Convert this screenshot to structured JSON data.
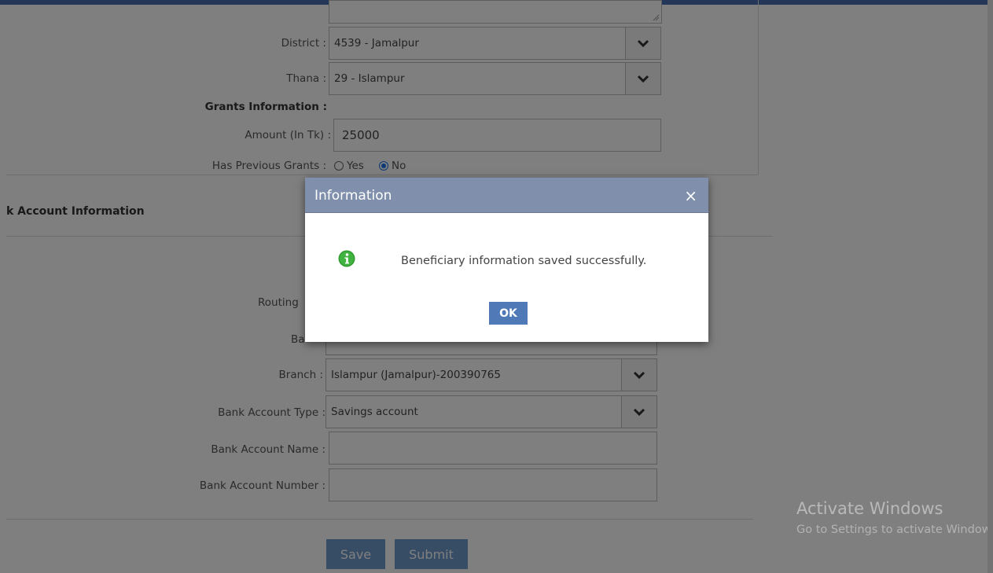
{
  "form": {
    "district": {
      "label": "District :",
      "value": "4539 - Jamalpur"
    },
    "thana": {
      "label": "Thana :",
      "value": "29 - Islampur"
    },
    "grants_heading": "Grants Information :",
    "amount": {
      "label": "Amount (In Tk) :",
      "value": "25000"
    },
    "previous_grants": {
      "label": "Has Previous Grants :",
      "yes": "Yes",
      "no": "No",
      "selected": "No"
    }
  },
  "bank": {
    "section_title": "k Account Information",
    "routing_label": "Routing",
    "bank_label_partial": "Ba",
    "branch": {
      "label": "Branch :",
      "value": "Islampur (Jamalpur)-200390765"
    },
    "account_type": {
      "label": "Bank Account Type :",
      "value": "Savings account"
    },
    "account_name": {
      "label": "Bank Account Name :",
      "value": ""
    },
    "account_number": {
      "label": "Bank Account Number :",
      "value": ""
    }
  },
  "actions": {
    "save": "Save",
    "submit": "Submit"
  },
  "dialog": {
    "title": "Information",
    "close": "×",
    "message": "Beneficiary information saved successfully.",
    "ok": "OK",
    "icon": "info-icon"
  },
  "watermark": {
    "line1": "Activate Windows",
    "line2": "Go to Settings to activate Windows."
  },
  "colors": {
    "dialog_header": "#7f8fac",
    "ok_button": "#4f79b7",
    "action_button": "#6f9acb"
  }
}
